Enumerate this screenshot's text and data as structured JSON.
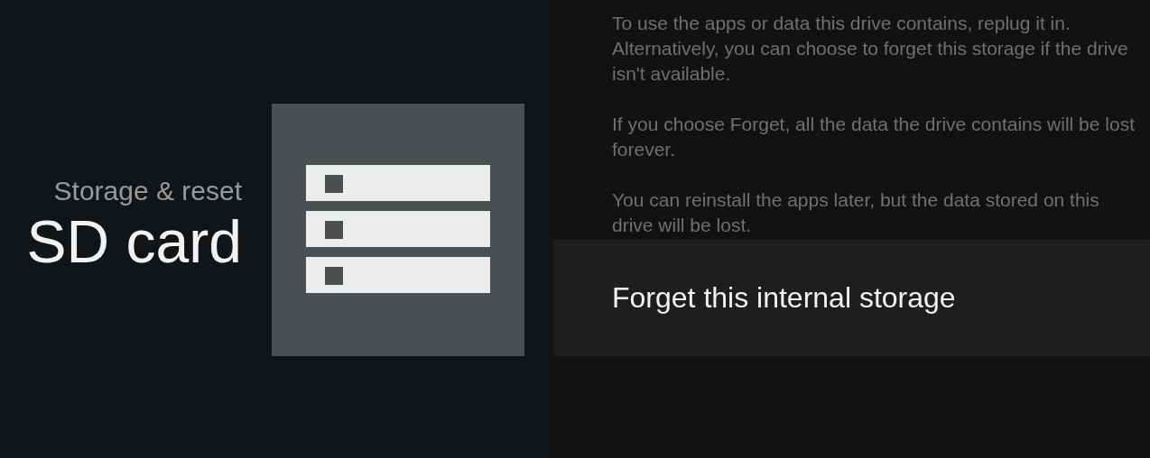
{
  "header": {
    "breadcrumb": "Storage & reset",
    "title": "SD card"
  },
  "paragraphs": [
    "To use the apps or data this drive contains, replug it in. Alternatively, you can choose to forget this storage if the drive isn't available.",
    "If you choose Forget, all the data the drive contains will be lost forever.",
    "You can reinstall the apps later, but the data stored on this drive will be lost."
  ],
  "actions": [
    {
      "label": "Forget this internal storage",
      "selected": true
    }
  ]
}
